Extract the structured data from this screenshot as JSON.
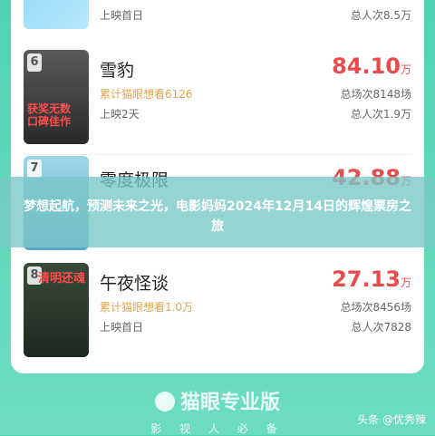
{
  "rows": [
    {
      "rank": "",
      "title": "",
      "want": "",
      "release": "上映首日",
      "box_value": "",
      "box_unit": "",
      "sessions": "",
      "audience": "总人次8.5万"
    },
    {
      "rank": "6",
      "title": "雪豹",
      "want": "累计猫眼想看6126",
      "release": "上映2天",
      "box_value": "84.10",
      "box_unit": "万",
      "sessions": "总场次8148场",
      "audience": "总人次1.9万"
    },
    {
      "rank": "7",
      "title": "零度极限",
      "want": "",
      "release": "",
      "box_value": "42.88",
      "box_unit": "万",
      "sessions": "",
      "audience": ""
    },
    {
      "rank": "8",
      "title": "午夜怪谈",
      "want": "累计猫眼想看1.0万",
      "release": "上映首日",
      "box_value": "27.13",
      "box_unit": "万",
      "sessions": "总场次8456场",
      "audience": "总人次7828"
    }
  ],
  "overlay": {
    "text": "梦想起航，预测未来之光，电影妈妈2024年12月14日的辉煌票房之旅"
  },
  "brand": {
    "name": "猫眼专业版",
    "slogan": "影 视 人 必 备"
  },
  "watermark": "头条 @优秀辣",
  "posters": {
    "p6_caption": "获奖无数 口碑佳作",
    "p8_caption": "清明还魂"
  }
}
